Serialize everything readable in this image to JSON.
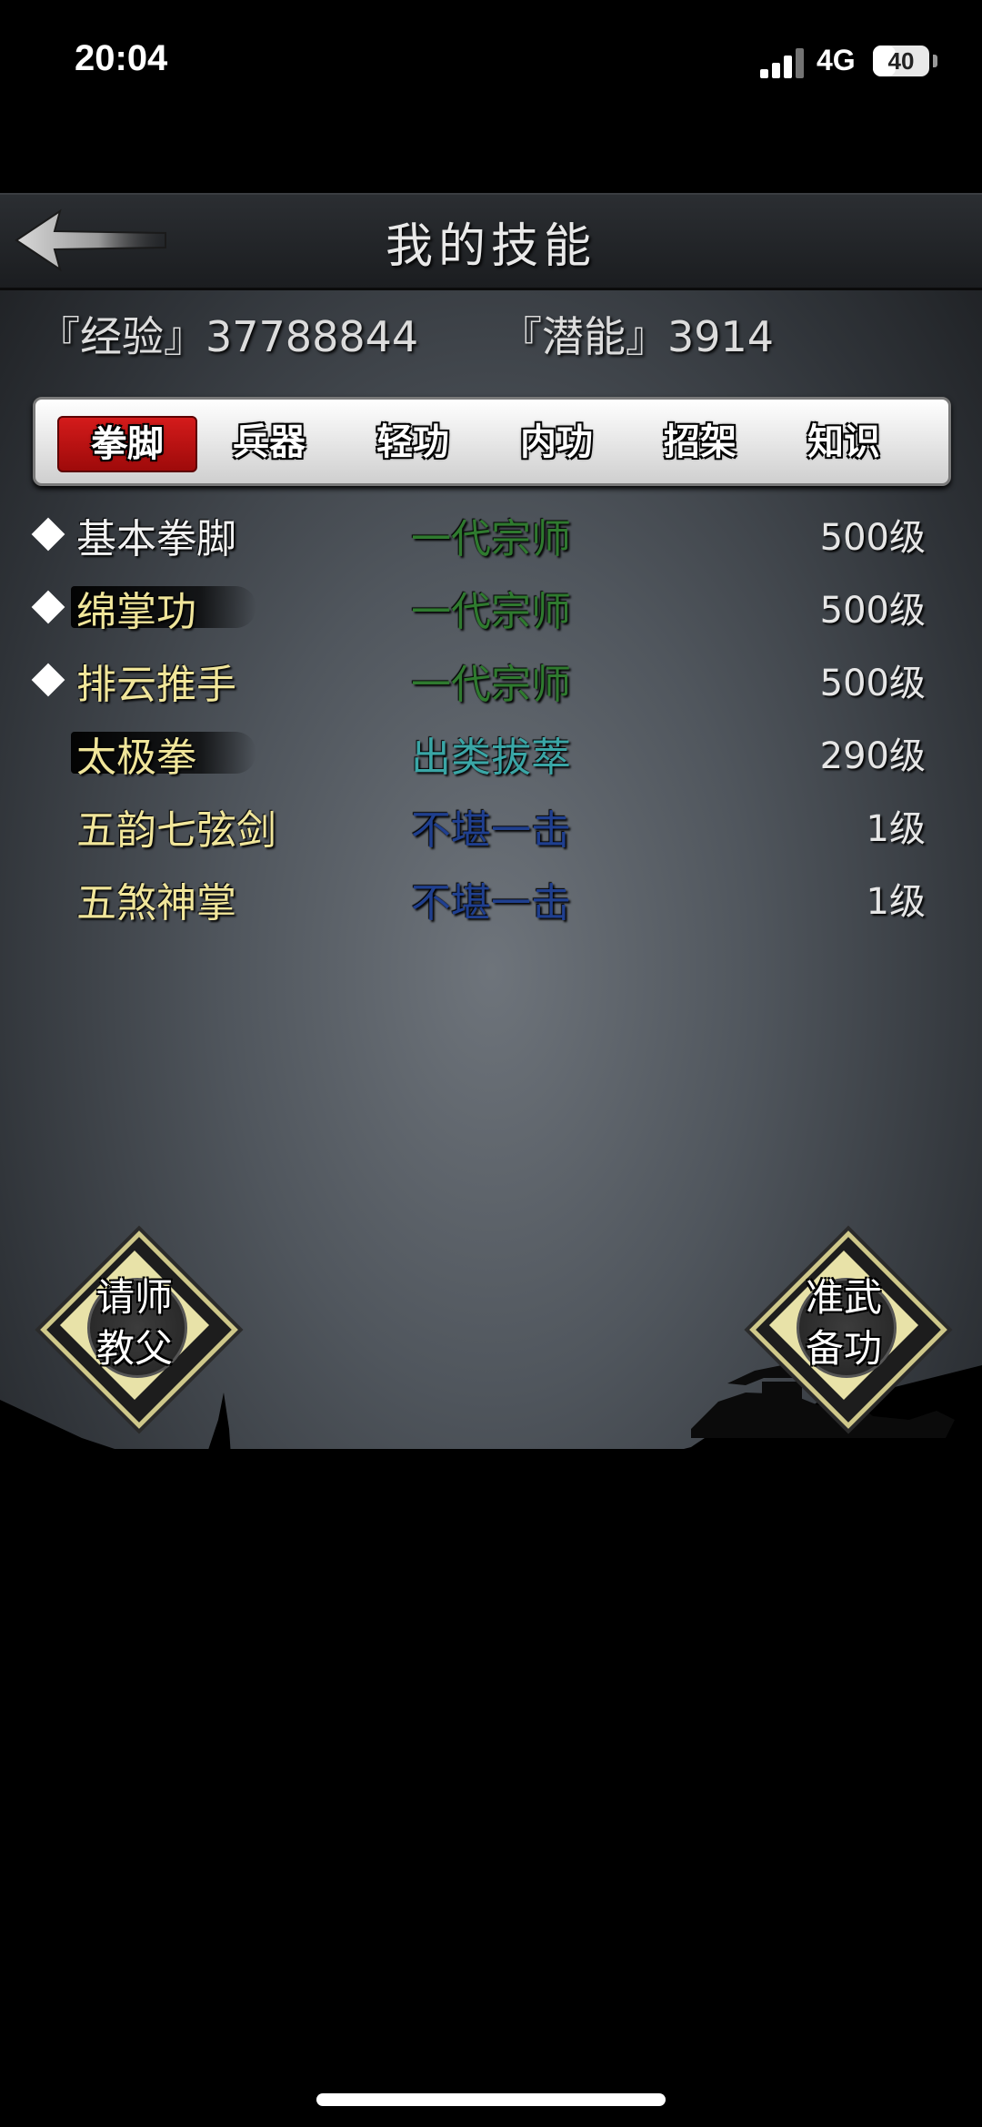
{
  "status_bar": {
    "time": "20:04",
    "network": "4G",
    "battery": "40",
    "battery_level": 0.4
  },
  "header": {
    "title": "我的技能"
  },
  "stats": {
    "experience": "『经验』37788844",
    "potential": "『潜能』3914"
  },
  "tabs": [
    {
      "label": "拳脚",
      "active": true
    },
    {
      "label": "兵器",
      "active": false
    },
    {
      "label": "轻功",
      "active": false
    },
    {
      "label": "内功",
      "active": false
    },
    {
      "label": "招架",
      "active": false
    },
    {
      "label": "知识",
      "active": false
    }
  ],
  "skills": [
    {
      "name": "基本拳脚",
      "rank": "一代宗师",
      "level": "500级",
      "marked": true,
      "rank_color": "#2f7a2f",
      "name_color": "#f2f2f2"
    },
    {
      "name": "绵掌功",
      "rank": "一代宗师",
      "level": "500级",
      "marked": true,
      "rank_color": "#2f7a2f",
      "name_color": "#f0e59a"
    },
    {
      "name": "排云推手",
      "rank": "一代宗师",
      "level": "500级",
      "marked": true,
      "rank_color": "#2f7a2f",
      "name_color": "#f0e59a"
    },
    {
      "name": "太极拳",
      "rank": "出类拔萃",
      "level": "290级",
      "marked": false,
      "rank_color": "#3aa6a6",
      "name_color": "#f0e59a"
    },
    {
      "name": "五韵七弦剑",
      "rank": "不堪一击",
      "level": "1级",
      "marked": false,
      "rank_color": "#1f3f8f",
      "name_color": "#f0e59a"
    },
    {
      "name": "五煞神掌",
      "rank": "不堪一击",
      "level": "1级",
      "marked": false,
      "rank_color": "#1f3f8f",
      "name_color": "#f0e59a"
    }
  ],
  "buttons": {
    "left": {
      "line1": "请师",
      "line2": "教父"
    },
    "right": {
      "line1": "准武",
      "line2": "备功"
    }
  },
  "colors": {
    "active_tab": "#c81414",
    "rank_green": "#2f7a2f",
    "rank_teal": "#3aa6a6",
    "rank_blue": "#1f3f8f"
  }
}
